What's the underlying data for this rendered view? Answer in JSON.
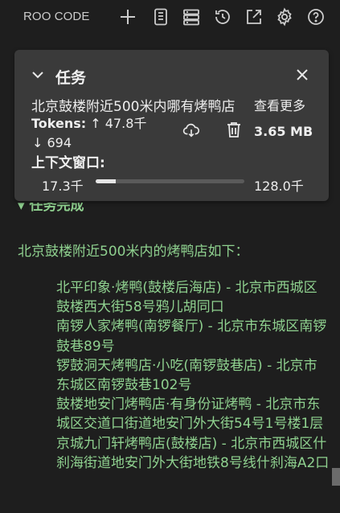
{
  "header": {
    "title": "ROO CODE",
    "icons": [
      "plus-icon",
      "prompts-icon",
      "servers-icon",
      "history-icon",
      "popout-icon",
      "gear-icon",
      "help-icon"
    ]
  },
  "task": {
    "title": "任务",
    "text": "北京鼓楼附近500米内哪有烤鸭店",
    "see_more": "查看更多",
    "tokens_label": "Tokens:",
    "tokens_up": "↑ 47.8千",
    "tokens_down": "↓ 694",
    "size": "3.65 MB",
    "context_label": "上下文窗口:",
    "context_used": "17.3千",
    "context_max": "128.0千",
    "context_fraction": 0.135
  },
  "chat": {
    "cut_line": "▾ 任务完成",
    "intro": "北京鼓楼附近500米内的烤鸭店如下：",
    "items": [
      "北平印象·烤鸭(鼓楼后海店) - 北京市西城区鼓楼西大街58号鸦儿胡同口",
      "南锣人家烤鸭(南锣餐厅) - 北京市东城区南锣鼓巷89号",
      "锣鼓洞天烤鸭店·小吃(南锣鼓巷店) - 北京市东城区南锣鼓巷102号",
      "鼓楼地安门烤鸭店·有身份证烤鸭 - 北京市东城区交道口街道地安门外大街54号1号楼1层",
      "京城九门轩烤鸭店(鼓楼店) - 北京市西城区什刹海街道地安门外大街地铁8号线什刹海A2口"
    ]
  },
  "colors": {
    "background": "#1e1e1e",
    "card": "#3a3a3a",
    "accent_green": "#8fd18f"
  }
}
